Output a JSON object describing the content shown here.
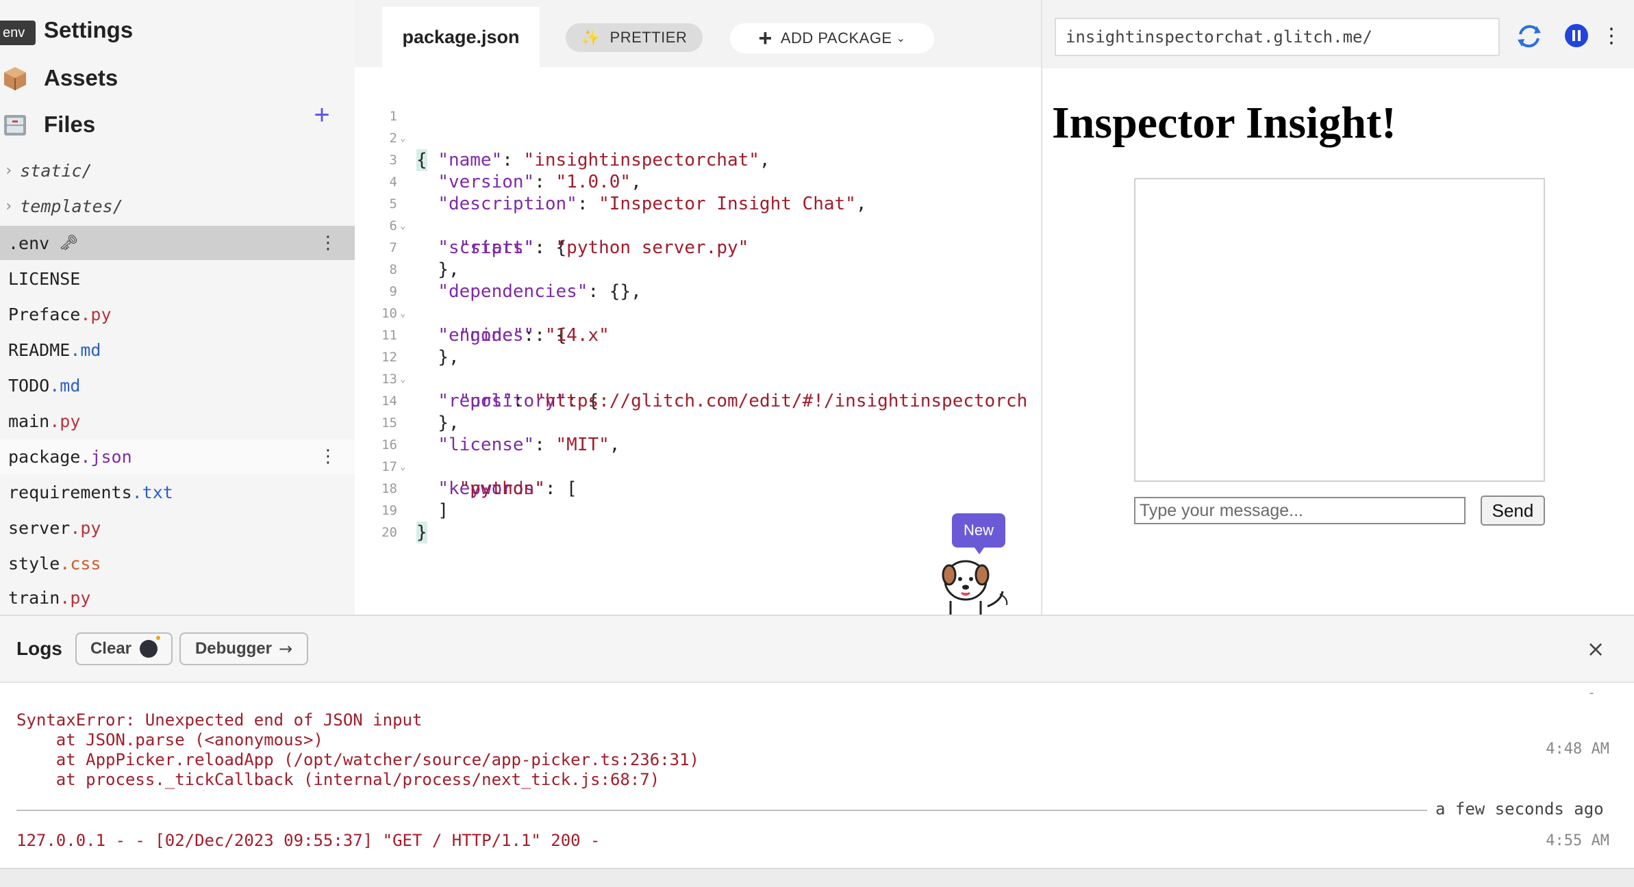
{
  "sidebar": {
    "tooltip": "env",
    "settings_label": "Settings",
    "assets_label": "Assets",
    "files_label": "Files",
    "files_add": "+",
    "folders": [
      {
        "chevron": "›",
        "name": "static/"
      },
      {
        "chevron": "›",
        "name": "templates/"
      }
    ],
    "files": [
      {
        "base": ".env",
        "ext": "",
        "icon": "key-icon"
      },
      {
        "base": "LICENSE",
        "ext": ""
      },
      {
        "base": "Preface",
        "ext": ".py"
      },
      {
        "base": "README",
        "ext": ".md"
      },
      {
        "base": "TODO",
        "ext": ".md"
      },
      {
        "base": "main",
        "ext": ".py"
      },
      {
        "base": "package",
        "ext": ".json"
      },
      {
        "base": "requirements",
        "ext": ".txt"
      },
      {
        "base": "server",
        "ext": ".py"
      },
      {
        "base": "style",
        "ext": ".css"
      },
      {
        "base": "train",
        "ext": ".py"
      }
    ],
    "row_menu": "⋮",
    "key_glyph": "🗝"
  },
  "editor": {
    "tab_label": "package.json",
    "prettier_label": "PRETTIER",
    "prettier_icon": "✨",
    "add_package_label": "ADD PACKAGE",
    "add_package_plus": "+",
    "add_package_chevron": "⌄",
    "line_numbers": [
      "1",
      "2",
      "3",
      "4",
      "5",
      "6",
      "7",
      "8",
      "9",
      "10",
      "11",
      "12",
      "13",
      "14",
      "15",
      "16",
      "17",
      "18",
      "19",
      "20"
    ],
    "fold_marks": [
      "⌄",
      "",
      "",
      "",
      "⌄",
      "",
      "",
      "",
      "⌄",
      "",
      "",
      "⌄",
      "",
      "",
      "",
      "⌄",
      "",
      "",
      "",
      ""
    ],
    "code": {
      "l1": "{",
      "l2_key": "\"name\"",
      "l2_val": "\"insightinspectorchat\"",
      "l3_key": "\"version\"",
      "l3_val": "\"1.0.0\"",
      "l4_key": "\"description\"",
      "l4_val": "\"Inspector Insight Chat\"",
      "l5_key": "\"scripts\"",
      "l6_key": "\"start\"",
      "l6_val": "\"python server.py\"",
      "l7": "},",
      "l8_key": "\"dependencies\"",
      "l9_key": "\"engines\"",
      "l10_key": "\"node\"",
      "l10_val": "\"14.x\"",
      "l11": "},",
      "l12_key": "\"repository\"",
      "l13_key": "\"url\"",
      "l13_val": "\"https://glitch.com/edit/#!/insightinspectorch",
      "l14": "},",
      "l15_key": "\"license\"",
      "l15_val": "\"MIT\"",
      "l16_key": "\"keywords\"",
      "l17_val": "\"python\"",
      "l18": "]",
      "l19": "}",
      "l20": ""
    },
    "new_badge": "New"
  },
  "preview": {
    "url": "insightinspectorchat.glitch.me/",
    "menu": "⋮",
    "title": "Inspector Insight!",
    "message_placeholder": "Type your message...",
    "send_label": "Send"
  },
  "logs": {
    "title": "Logs",
    "clear_label": "Clear",
    "debugger_label": "Debugger",
    "debugger_arrow": "→",
    "close": "×",
    "dash": "-",
    "error_lines": [
      "SyntaxError: Unexpected end of JSON input",
      "    at JSON.parse (<anonymous>)",
      "    at AppPicker.reloadApp (/opt/watcher/source/app-picker.ts:236:31)",
      "    at process._tickCallback (internal/process/next_tick.js:68:7)"
    ],
    "error_time": "4:48 AM",
    "divider_label": "a few seconds ago",
    "request_line": "127.0.0.1 - - [02/Dec/2023 09:55:37] \"GET / HTTP/1.1\" 200 -",
    "request_time": "4:55 AM"
  },
  "colors": {
    "accent": "#5a55e0",
    "badge": "#6a5ad6",
    "error_text": "#a11d2b",
    "json_key": "#7e2aa8",
    "json_string": "#a11d2b",
    "refresh": "#2b6fe0",
    "pause": "#2244dd"
  }
}
